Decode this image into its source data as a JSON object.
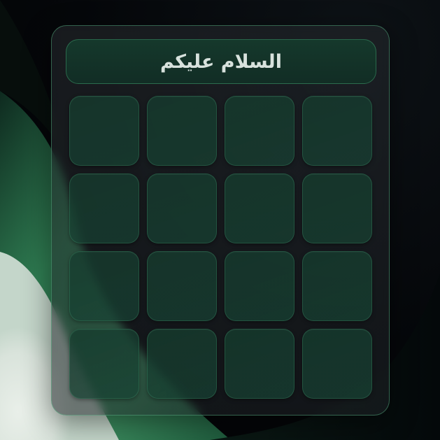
{
  "header": {
    "title": "السلام عليكم"
  },
  "keypad": {
    "keys": [
      {
        "label": ""
      },
      {
        "label": ""
      },
      {
        "label": ""
      },
      {
        "label": ""
      },
      {
        "label": ""
      },
      {
        "label": ""
      },
      {
        "label": ""
      },
      {
        "label": ""
      },
      {
        "label": ""
      },
      {
        "label": ""
      },
      {
        "label": ""
      },
      {
        "label": ""
      },
      {
        "label": ""
      },
      {
        "label": ""
      },
      {
        "label": ""
      },
      {
        "label": ""
      }
    ]
  },
  "colors": {
    "accent": "#2e7d55",
    "panel_border": "#4fae82",
    "title_text": "#d8e2dd",
    "key_fill": "#17402f",
    "background": "#05070a"
  }
}
